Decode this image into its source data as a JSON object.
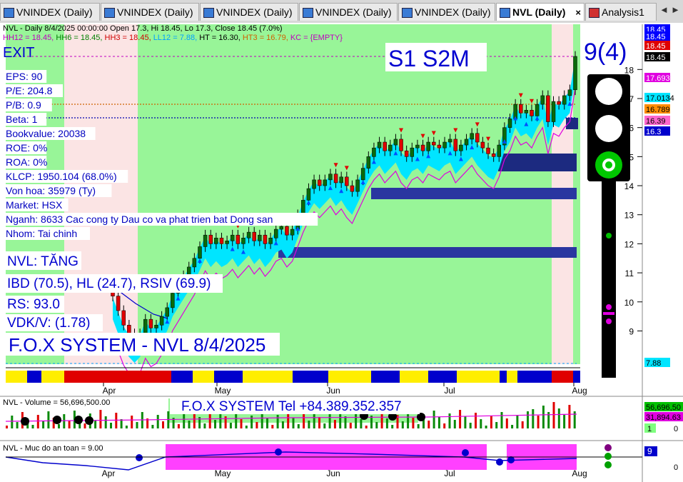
{
  "tabs": [
    {
      "label": "VNINDEX (Daily)",
      "active": false
    },
    {
      "label": "VNINDEX (Daily)",
      "active": false
    },
    {
      "label": "VNINDEX (Daily)",
      "active": false
    },
    {
      "label": "VNINDEX (Daily)",
      "active": false
    },
    {
      "label": "VNINDEX (Daily)",
      "active": false
    },
    {
      "label": "NVL (Daily)",
      "active": true
    },
    {
      "label": "Analysis1",
      "active": false
    }
  ],
  "tab_close": "×",
  "nav_left": "◄",
  "nav_right": "►",
  "header": {
    "line1": "NVL - Daily 8/4/2025 00:00:00 Open 17.3, Hi 18.45, Lo 17.3, Close 18.45 (7.0%)",
    "line2": [
      {
        "text": "HH12 = 18.45, ",
        "color": "#c000c0"
      },
      {
        "text": "HH6 = 18.45, ",
        "color": "#008000"
      },
      {
        "text": "HH3 = 18.45, ",
        "color": "#d00000"
      },
      {
        "text": "LL12 = 7.88, ",
        "color": "#00a0ff"
      },
      {
        "text": "HT  = 16.30, ",
        "color": "#000000"
      },
      {
        "text": "HT3 = 16.79, ",
        "color": "#d06000"
      },
      {
        "text": "KC = {EMPTY}",
        "color": "#c000c0"
      }
    ]
  },
  "overlay": {
    "exit": "EXIT",
    "s1s2m": "S1  S2M",
    "signal": "9(4)",
    "fundamentals": [
      "EPS: 90",
      "P/E: 204.8",
      "P/B: 0.9",
      "Beta: 1",
      "Bookvalue: 20038",
      "ROE: 0%",
      "ROA: 0%",
      "KLCP: 1950.104 (68.0%)",
      "Von hoa: 35979 (Ty)",
      "Market: HSX",
      "Nganh: 8633 Cac cong ty Dau co va phat trien bat Dong san",
      "Nhom: Tai chinh"
    ],
    "trend": "NVL: TĂNG",
    "ibd": "IBD (70.5), HL (24.7), RSIV (69.9)",
    "rs": "RS: 93.0",
    "vdk": "VDK/V:  (1.78)",
    "system": "F.O.X SYSTEM - NVL 8/4/2025",
    "tel": "F.O.X SYSTEM Tel +84.389.352.357"
  },
  "volume_panel": {
    "label": "NVL - Volume = 56,696,500.00",
    "badges": [
      "56,696,50",
      "31,894.63",
      "1"
    ],
    "zero": "0"
  },
  "safety_panel": {
    "label": "NVL - Muc do an toan = 9.00",
    "badge": "9",
    "zero": "0"
  },
  "colors": {
    "green": "#98f598",
    "pink": "#fbe4e4",
    "navy": "#1c2a80",
    "cyan": "#00e5ff",
    "magenta": "#e000e0",
    "up": "#0a6a0a",
    "down": "#e00000"
  },
  "chart_data": {
    "type": "candlestick",
    "title": "NVL - Daily 8/4/2025",
    "ylim": [
      8.2,
      19.3
    ],
    "ytick_labels": [
      "18",
      "17",
      "16",
      "15",
      "14",
      "13",
      "12",
      "11",
      "10",
      "9"
    ],
    "xtick_labels": [
      "Apr",
      "May",
      "Jun",
      "Jul",
      "Aug"
    ],
    "right_badges": [
      {
        "text": "18.45",
        "bg": "#0000ff",
        "fg": "#ffffff"
      },
      {
        "text": "18.45",
        "bg": "#0000ff",
        "fg": "#ffffff"
      },
      {
        "text": "18.45",
        "bg": "#e00000",
        "fg": "#ffffff"
      },
      {
        "text": "18.45",
        "bg": "#000000",
        "fg": "#ffffff"
      },
      {
        "text": "17.6935",
        "bg": "#e000e0",
        "fg": "#ffffff"
      },
      {
        "text": "17.0134",
        "bg": "#00e5ff",
        "fg": "#000000"
      },
      {
        "text": "16.789",
        "bg": "#ff8c00",
        "fg": "#000000"
      },
      {
        "text": "16.39",
        "bg": "#ff66cc",
        "fg": "#000000"
      },
      {
        "text": "16.3",
        "bg": "#0000cc",
        "fg": "#ffffff"
      },
      {
        "text": "7.88",
        "bg": "#00e5ff",
        "fg": "#000000"
      }
    ],
    "close": [
      10.2,
      9.7,
      9.2,
      8.9,
      8.7,
      8.9,
      9.4,
      9.1,
      9.2,
      9.5,
      9.8,
      10.3,
      10.6,
      10.9,
      11.2,
      11.5,
      11.9,
      12.3,
      12.0,
      12.2,
      12.0,
      12.1,
      12.3,
      12.0,
      12.2,
      12.4,
      12.1,
      12.3,
      12.0,
      12.2,
      12.5,
      12.6,
      12.3,
      12.5,
      13.0,
      13.5,
      13.9,
      14.2,
      14.0,
      14.2,
      14.4,
      14.1,
      14.3,
      14.0,
      13.8,
      14.2,
      14.6,
      15.0,
      15.3,
      15.5,
      15.2,
      15.4,
      15.6,
      15.2,
      15.0,
      15.3,
      15.4,
      15.2,
      15.5,
      15.4,
      15.3,
      15.5,
      15.6,
      15.2,
      15.4,
      15.6,
      15.8,
      15.5,
      15.3,
      15.1,
      15.0,
      15.4,
      16.0,
      16.3,
      16.8,
      16.5,
      16.6,
      16.4,
      16.8,
      17.1,
      16.2,
      16.9,
      16.8,
      17.1,
      17.3,
      18.45
    ]
  }
}
